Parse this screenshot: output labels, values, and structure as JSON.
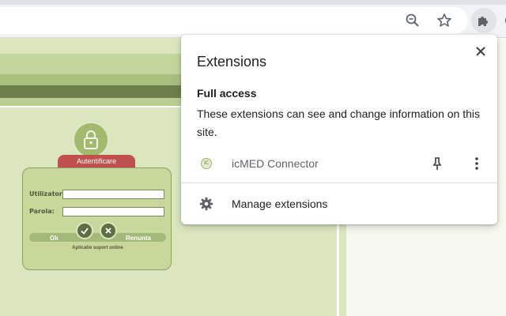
{
  "toolbar": {
    "icons": [
      "zoom-out-icon",
      "star-icon",
      "puzzle-icon",
      "profile-icon"
    ]
  },
  "login": {
    "banner": "Autentificare",
    "user_label": "Utilizator:",
    "pass_label": "Parola:",
    "ok_label": "Ok",
    "cancel_label": "Renunta",
    "support_text": "Aplicatie suport online"
  },
  "popup": {
    "title": "Extensions",
    "section_title": "Full access",
    "section_desc": "These extensions can see and change information on this site.",
    "extension": {
      "name": "icMED Connector",
      "icon_text": "iC"
    },
    "manage_label": "Manage extensions"
  },
  "colors": {
    "page_bg": "#dbe6bf",
    "dark_band": "#6d7f4a",
    "banner_red": "#c0504d"
  }
}
